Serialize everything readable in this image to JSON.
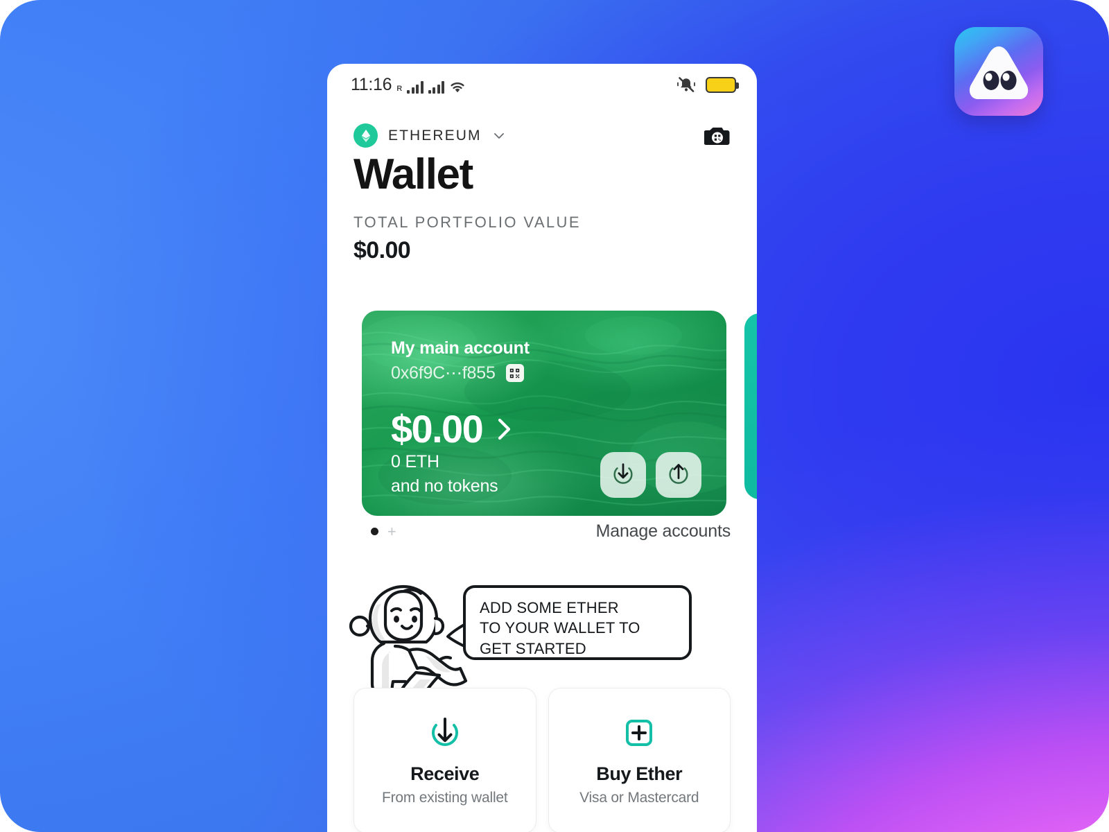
{
  "app_logo": {
    "icon": "ghost-eyes-app-icon"
  },
  "status_bar": {
    "time": "11:16",
    "roaming": "R",
    "icons": [
      "signal-bars-icon",
      "signal-bars-icon",
      "wifi-icon",
      "mute-bell-icon",
      "battery-icon"
    ],
    "battery_color": "#f7d117"
  },
  "header": {
    "chain": "ETHEREUM",
    "chain_icon": "ethereum-icon",
    "chain_caret": "chevron-down-icon",
    "scan_icon": "qr-camera-icon",
    "title": "Wallet",
    "portfolio_label": "TOTAL PORTFOLIO VALUE",
    "portfolio_value": "$0.00"
  },
  "account_card": {
    "name": "My main account",
    "address": "0x6f9C⋯f855",
    "qr_icon": "qr-code-icon",
    "balance": "$0.00",
    "chevron": "chevron-right-icon",
    "token_line_1": "0 ETH",
    "token_line_2": "and no tokens",
    "receive_icon": "arrow-down-circle-icon",
    "send_icon": "arrow-up-circle-icon"
  },
  "carousel": {
    "active_dot": "●",
    "add_account": "+",
    "manage_accounts": "Manage accounts"
  },
  "mascot": {
    "character": "astronaut-mascot",
    "bubble_line_1": "ADD SOME ETHER",
    "bubble_line_2": "TO YOUR WALLET TO",
    "bubble_line_3": "GET STARTED"
  },
  "actions": [
    {
      "icon": "arrow-down-circle-icon",
      "title": "Receive",
      "subtitle": "From existing wallet"
    },
    {
      "icon": "plus-square-icon",
      "title": "Buy Ether",
      "subtitle": "Visa or Mastercard"
    }
  ],
  "colors": {
    "accent_teal": "#13bfa6",
    "card_green": "#17994f",
    "peek_card_teal": "#12c0a4",
    "bg_blue": "#4180f7",
    "bg_indigo": "#2f3bf0",
    "bg_magenta": "#e667f5"
  }
}
